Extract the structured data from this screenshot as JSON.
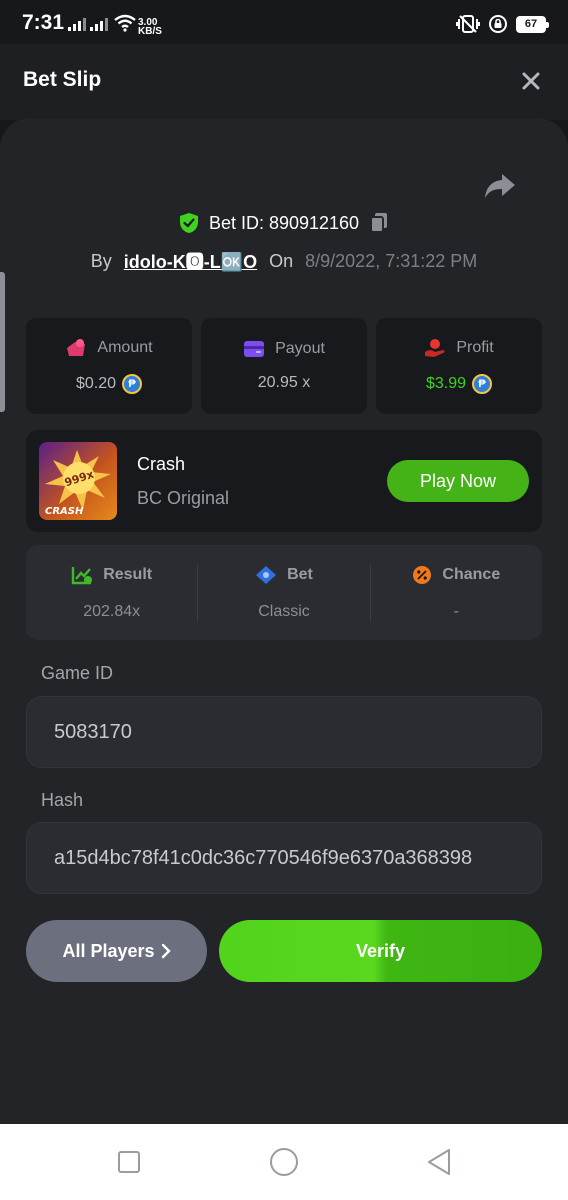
{
  "status_bar": {
    "time": "7:31",
    "speed_value": "3.00",
    "speed_unit": "KB/S",
    "battery": "67"
  },
  "header": {
    "title": "Bet Slip"
  },
  "bet": {
    "id_label": "Bet ID: 890912160",
    "by_label": "By",
    "username": "idolo-K🅾-L🆗O",
    "on_label": "On",
    "datetime": "8/9/2022, 7:31:22 PM"
  },
  "stats": {
    "amount": {
      "label": "Amount",
      "value": "$0.20"
    },
    "payout": {
      "label": "Payout",
      "value": "20.95 x"
    },
    "profit": {
      "label": "Profit",
      "value": "$3.99"
    },
    "coin_symbol": "₱"
  },
  "game": {
    "name": "Crash",
    "subtitle": "BC Original",
    "thumb_multiplier": "999x",
    "thumb_title": "CRASH",
    "play_label": "Play Now"
  },
  "results": {
    "result": {
      "label": "Result",
      "value": "202.84x"
    },
    "bet": {
      "label": "Bet",
      "value": "Classic"
    },
    "chance": {
      "label": "Chance",
      "value": "-"
    }
  },
  "fields": {
    "game_id": {
      "label": "Game ID",
      "value": "5083170"
    },
    "hash": {
      "label": "Hash",
      "value": "a15d4bc78f41c0dc36c770546f9e6370a368398"
    }
  },
  "buttons": {
    "all_players": "All Players",
    "verify": "Verify"
  },
  "colors": {
    "green": "#45b318",
    "profit": "#3fd320",
    "verified_shield": "#3fd320",
    "card_bg": "#232428"
  }
}
